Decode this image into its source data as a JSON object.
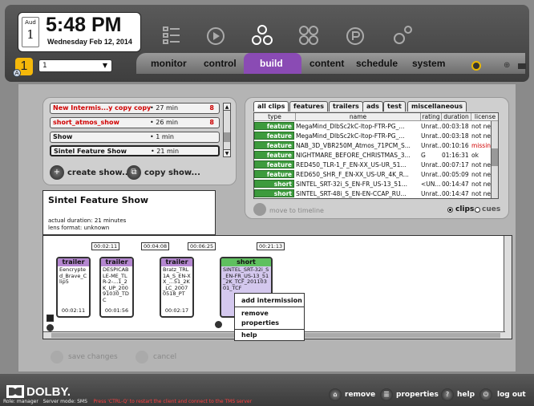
{
  "clock": {
    "month": "Aud",
    "day": "1",
    "time": "5:48 PM",
    "date": "Wednesday Feb 12, 2014"
  },
  "header": {
    "library_number": "1",
    "library_badge": "A",
    "screen_select": "1"
  },
  "nav": {
    "tabs": [
      "monitor",
      "control",
      "build",
      "content",
      "schedule",
      "system"
    ],
    "active": "build"
  },
  "shows": {
    "items": [
      {
        "name": "New Intermis...y copy copy",
        "duration": "27 min",
        "count": "8"
      },
      {
        "name": "short_atmos_show",
        "duration": "26 min",
        "count": "8"
      },
      {
        "name": "Show",
        "duration": "1 min",
        "count": ""
      },
      {
        "name": "Sintel Feature Show",
        "duration": "21 min",
        "count": ""
      }
    ],
    "create_label": "create show...",
    "copy_label": "copy show...",
    "info": {
      "title": "Sintel Feature Show",
      "duration": "actual duration: 21 minutes",
      "lens": "lens format: unknown"
    }
  },
  "clips": {
    "tabs": [
      "all clips",
      "features",
      "trailers",
      "ads",
      "test",
      "miscellaneous"
    ],
    "columns": [
      "type",
      "name",
      "rating",
      "duration",
      "license"
    ],
    "rows": [
      {
        "type": "feature",
        "name": "MegaMind_DlbSc2kC-ltop-FTR-PG_...",
        "rating": "Unrat...",
        "duration": "00:03:18",
        "license": "not nee..."
      },
      {
        "type": "feature",
        "name": "MegaMind_DlbSc2kC-ltop-FTR-PG_...",
        "rating": "Unrat...",
        "duration": "00:03:18",
        "license": "not nee..."
      },
      {
        "type": "feature",
        "name": "NAB_3D_VBR250M_Atmos_71PCM_S...",
        "rating": "Unrat...",
        "duration": "00:10:16",
        "license": "missing"
      },
      {
        "type": "feature",
        "name": "NIGHTMARE_BEFORE_CHRISTMAS_3...",
        "rating": "G",
        "duration": "01:16:31",
        "license": "ok"
      },
      {
        "type": "feature",
        "name": "RED450_TLR-1_F_EN-XX_US-UR_51...",
        "rating": "Unrat...",
        "duration": "00:07:17",
        "license": "not nee..."
      },
      {
        "type": "feature",
        "name": "RED650_SHR_F_EN-XX_US-UR_4K_R...",
        "rating": "Unrat...",
        "duration": "00:05:09",
        "license": "not nee..."
      },
      {
        "type": "short",
        "name": "SINTEL_SRT-32i_S_EN-FR_US-13_51...",
        "rating": "<UN...",
        "duration": "00:14:47",
        "license": "not nee..."
      },
      {
        "type": "short",
        "name": "SINTEL_SRT-48i_S_EN-EN-CCAP_RU...",
        "rating": "Unrat...",
        "duration": "00:14:47",
        "license": "not nee..."
      }
    ],
    "move_label": "move to timeline",
    "radio_clips": "clips",
    "radio_cues": "cues"
  },
  "timeline": {
    "marks": [
      "00:02:11",
      "00:04:08",
      "00:06:25",
      "00:21:13"
    ],
    "clips": [
      {
        "type": "trailer",
        "name": "Eencrypted_Brave_Clip5",
        "duration": "00:02:11"
      },
      {
        "type": "trailer",
        "name": "DESPICABLE-ME_TLR-2-...1_2K_UP_20091030_TDC",
        "duration": "00:01:56"
      },
      {
        "type": "trailer",
        "name": "Bratz_TRL1A_S_EN-XX_...51_2K_LC_20070518_PT",
        "duration": "00:02:17"
      }
    ],
    "short": {
      "type": "short",
      "name": "SINTEL_SRT-32i_S_EN-FR_US-13_51_2K_TCF_20110301_TCF"
    }
  },
  "context_menu": [
    "add intermission",
    "remove",
    "properties",
    "help"
  ],
  "actions": {
    "save": "save changes",
    "cancel": "cancel"
  },
  "footer": {
    "brand": "DOLBY.",
    "role": "Role: manager",
    "server": "Server mode: SMS",
    "warning": "Press 'CTRL-Q' to restart the client and connect to the TMS server",
    "buttons": [
      "remove",
      "properties",
      "help",
      "log out"
    ]
  }
}
